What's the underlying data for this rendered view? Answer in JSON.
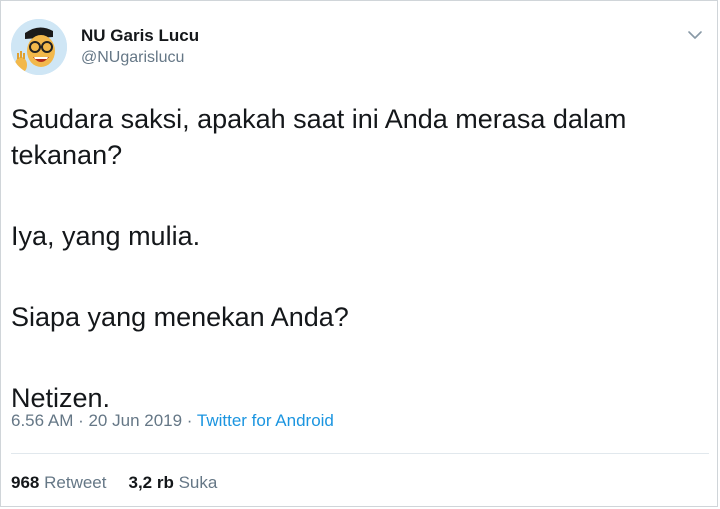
{
  "tweet": {
    "author": {
      "display_name": "NU Garis Lucu",
      "handle": "@NUgarislucu",
      "avatar_icon": "cartoon-avatar-icon"
    },
    "menu_icon": "chevron-down-icon",
    "lines": [
      "Saudara saksi, apakah saat ini Anda merasa dalam",
      "tekanan?",
      "Iya, yang mulia.",
      "Siapa yang menekan Anda?",
      "Netizen."
    ],
    "timestamp": "6.56 AM · 20 Jun 2019",
    "separator": " · ",
    "source": "Twitter for Android",
    "stats": {
      "retweets_count": "968",
      "retweets_label": "Retweet",
      "likes_count": "3,2 rb",
      "likes_label": "Suka"
    }
  },
  "colors": {
    "text": "#14171a",
    "secondary": "#657786",
    "link": "#1b95e0",
    "border": "#d0d5d9"
  }
}
